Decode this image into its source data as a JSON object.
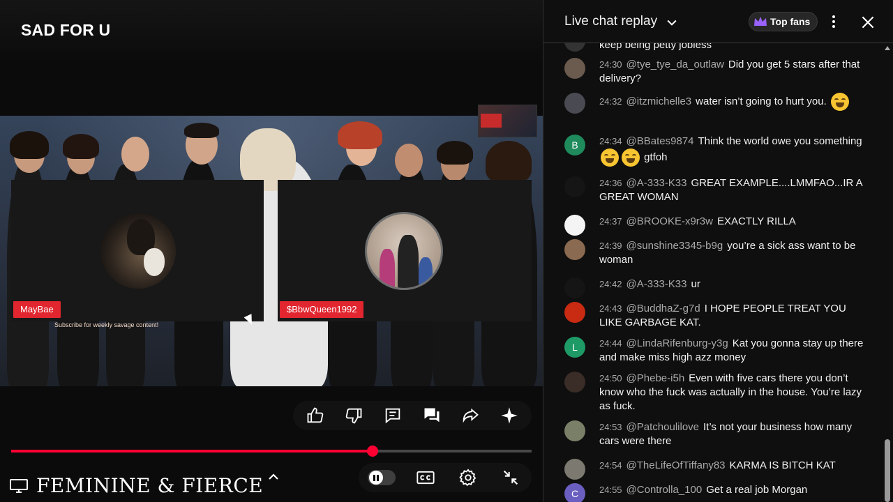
{
  "player": {
    "title": "SAD FOR U",
    "left_cam_name": "MayBae",
    "right_cam_name": "$BbwQueen1992",
    "subscribe_note": "Subscribe for weekly savage content!",
    "channel_name": "FEMININE & FIERCE",
    "progress_fraction": 0.695,
    "accent_color": "#ff0033"
  },
  "actions": [
    "like-icon",
    "dislike-icon",
    "comment-icon",
    "chat-icon",
    "share-icon",
    "sparkle-icon"
  ],
  "controls": [
    "pause-toggle",
    "cc-icon",
    "settings-gear-icon",
    "exit-fullscreen-icon"
  ],
  "chat": {
    "header_title": "Live chat replay",
    "top_fans_label": "Top fans",
    "truncated_top": "keep being petty jobless",
    "messages": [
      {
        "time": "24:30",
        "author": "@tye_tye_da_outlaw",
        "text": "Did you get 5 stars after that delivery?",
        "avatar_color": "#6b5a4e",
        "initial": ""
      },
      {
        "time": "24:32",
        "author": "@itzmichelle3",
        "text": "water isn’t going to hurt you.",
        "emojis": 1,
        "avatar_color": "#4a4a52",
        "initial": ""
      },
      {
        "time": "24:34",
        "author": "@BBates9874",
        "text": "Think the world owe you something",
        "text_after": "gtfoh",
        "emojis": 2,
        "avatar_color": "#1f8a5c",
        "initial": "B"
      },
      {
        "time": "24:36",
        "author": "@A-333-K33",
        "text": "GREAT EXAMPLE....LMMFAO...IR A GREAT WOMAN",
        "avatar_color": "#151515",
        "initial": ""
      },
      {
        "time": "24:37",
        "author": "@BROOKE-x9r3w",
        "text": "EXACTLY RILLA",
        "avatar_color": "#f4f4f4",
        "initial": ""
      },
      {
        "time": "24:39",
        "author": "@sunshine3345-b9g",
        "text": "you’re a sick ass want to be woman",
        "avatar_color": "#8a6a50",
        "initial": ""
      },
      {
        "time": "24:42",
        "author": "@A-333-K33",
        "text": "ur",
        "avatar_color": "#151515",
        "initial": ""
      },
      {
        "time": "24:43",
        "author": "@BuddhaZ-g7d",
        "text": "I HOPE PEOPLE TREAT YOU LIKE GARBAGE KAT.",
        "avatar_color": "#c82a12",
        "initial": ""
      },
      {
        "time": "24:44",
        "author": "@LindaRifenburg-y3g",
        "text": "Kat you gonna stay up there and make miss high azz money",
        "avatar_color": "#1e9a66",
        "initial": "L"
      },
      {
        "time": "24:50",
        "author": "@Phebe-i5h",
        "text": "Even with five cars there you don’t know who the fuck was actually in the house. You’re lazy as fuck.",
        "avatar_color": "#3a2c26",
        "initial": ""
      },
      {
        "time": "24:53",
        "author": "@Patchoulilove",
        "text": "It’s not your business how many cars were there",
        "avatar_color": "#7a8068",
        "initial": ""
      },
      {
        "time": "24:54",
        "author": "@TheLifeOfTiffany83",
        "text": "KARMA IS BITCH KAT",
        "avatar_color": "#7c7a70",
        "initial": ""
      },
      {
        "time": "24:55",
        "author": "@Controlla_100",
        "text": "Get a real job Morgan",
        "avatar_color": "#6a5fc0",
        "initial": "C"
      }
    ]
  }
}
